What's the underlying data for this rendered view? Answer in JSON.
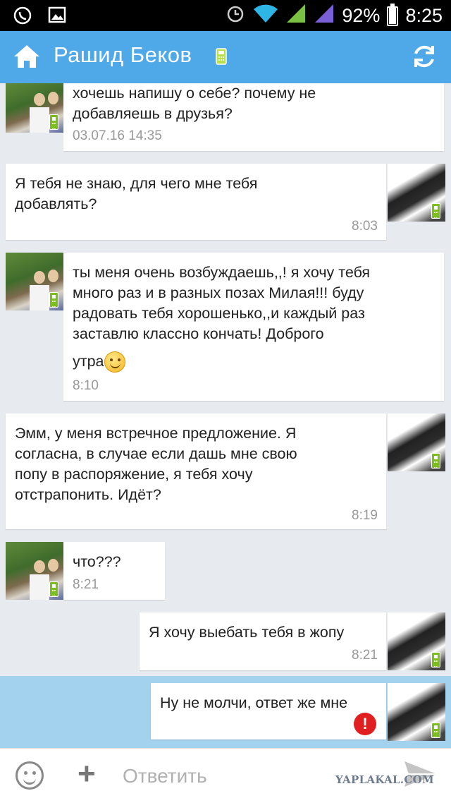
{
  "status_bar": {
    "battery": "92%",
    "battery_level": 0.92,
    "time": "8:25",
    "icons": [
      "viber-icon",
      "gallery-icon",
      "alarm-icon",
      "wifi-icon",
      "signal-icon",
      "signal-icon-2",
      "battery-icon"
    ]
  },
  "app_bar": {
    "title": "Рашид Беков",
    "icons": [
      "home-icon",
      "mobile-status-icon",
      "refresh-icon"
    ]
  },
  "messages": [
    {
      "direction": "in",
      "text_lines": [
        "хочешь напишу о себе? почему не",
        "добавляешь в друзья?"
      ],
      "time": "03.07.16 14:35"
    },
    {
      "direction": "out",
      "text_lines": [
        "Я тебя не знаю, для чего мне тебя",
        "добавлять?"
      ],
      "time": "8:03"
    },
    {
      "direction": "in",
      "text_lines": [
        "ты меня очень возбуждаешь,,! я хочу тебя",
        "много раз и в разных позах Милая!!! буду",
        "радовать тебя хорошенько,,и каждый раз",
        "заставлю классно кончать! Доброго",
        "утра"
      ],
      "emoji": "smile-emoji-icon",
      "time": "8:10"
    },
    {
      "direction": "out",
      "text_lines": [
        "Эмм, у меня встречное предложение. Я",
        "согласна, в случае если дашь мне свою",
        "попу в распоряжение, я тебя хочу",
        "отстрапонить. Идёт?"
      ],
      "time": "8:19"
    },
    {
      "direction": "in",
      "text_lines": [
        "что???"
      ],
      "time": "8:21"
    },
    {
      "direction": "out",
      "text_lines": [
        "Я хочу выебать тебя в жопу"
      ],
      "time": "8:21"
    },
    {
      "direction": "out",
      "text_lines": [
        "Ну не молчи, ответ же мне"
      ],
      "status": "!",
      "status_icon": "error-icon"
    }
  ],
  "input_bar": {
    "placeholder": "Ответить",
    "icons": [
      "emoji-icon",
      "plus-icon",
      "send-icon"
    ]
  },
  "watermark": "YAPLAKAL.COM",
  "colors": {
    "app_bar": "#4fa8e8",
    "chat_background": "#e7ebf0",
    "highlight_row": "#a3d2ee",
    "mobile_badge": "#7cbd1f",
    "error": "#e02020"
  }
}
